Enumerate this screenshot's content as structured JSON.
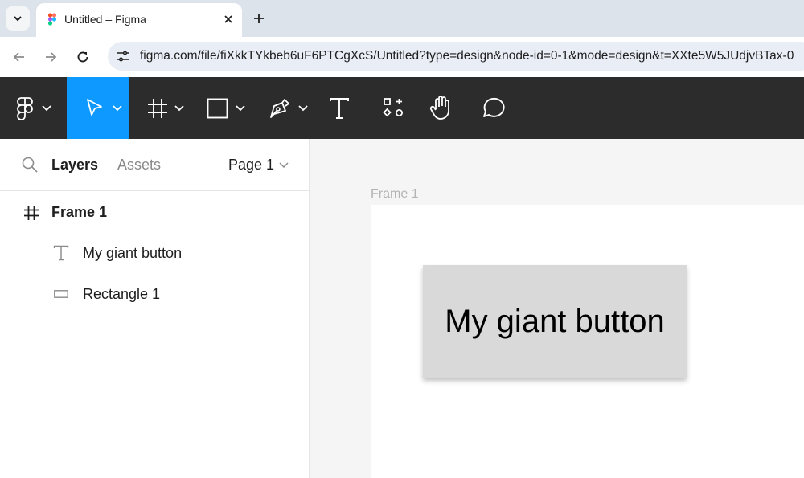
{
  "browser": {
    "tab_title": "Untitled – Figma",
    "url": "figma.com/file/fiXkkTYkbeb6uF6PTCgXcS/Untitled?type=design&node-id=0-1&mode=design&t=XXte5W5JUdjvBTax-0"
  },
  "toolbar": {
    "tools": [
      {
        "name": "main-menu",
        "icon": "figma-logo-icon",
        "has_dropdown": true
      },
      {
        "name": "move",
        "icon": "cursor-icon",
        "has_dropdown": true,
        "active": true
      },
      {
        "name": "frame",
        "icon": "frame-hash-icon",
        "has_dropdown": true
      },
      {
        "name": "shape",
        "icon": "rectangle-icon",
        "has_dropdown": true
      },
      {
        "name": "pen",
        "icon": "pen-icon",
        "has_dropdown": true
      },
      {
        "name": "text",
        "icon": "text-icon",
        "has_dropdown": false
      },
      {
        "name": "resources",
        "icon": "resources-icon",
        "has_dropdown": false
      },
      {
        "name": "hand",
        "icon": "hand-icon",
        "has_dropdown": false
      },
      {
        "name": "comment",
        "icon": "comment-icon",
        "has_dropdown": false
      }
    ],
    "active_color": "#0d99ff",
    "background": "#2c2c2c"
  },
  "left_panel": {
    "tab_layers": "Layers",
    "tab_assets": "Assets",
    "page": "Page 1",
    "layers": [
      {
        "label": "Frame 1",
        "icon": "frame-hash-icon",
        "level": 0
      },
      {
        "label": "My giant button",
        "icon": "text-icon",
        "level": 1
      },
      {
        "label": "Rectangle 1",
        "icon": "rectangle-icon",
        "level": 1
      }
    ]
  },
  "canvas": {
    "frame_label": "Frame 1",
    "button_text": "My giant button"
  }
}
